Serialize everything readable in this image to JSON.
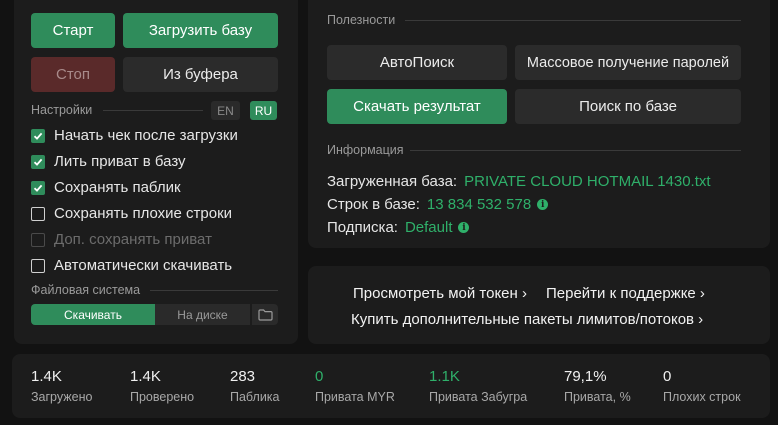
{
  "controls": {
    "start": "Старт",
    "load_base": "Загрузить базу",
    "stop": "Стоп",
    "from_buffer": "Из буфера"
  },
  "settings": {
    "label": "Настройки",
    "lang_en": "EN",
    "lang_ru": "RU",
    "options": [
      {
        "label": "Начать чек после загрузки",
        "checked": true
      },
      {
        "label": "Лить приват в базу",
        "checked": true
      },
      {
        "label": "Сохранять паблик",
        "checked": true
      },
      {
        "label": "Сохранять плохие строки",
        "checked": false
      },
      {
        "label": "Доп. сохранять приват",
        "checked": false,
        "disabled": true
      },
      {
        "label": "Автоматически скачивать",
        "checked": false
      }
    ]
  },
  "filesystem": {
    "label": "Файловая система",
    "download": "Скачивать",
    "on_disk": "На диске",
    "folder_icon": "folder-icon"
  },
  "utilities": {
    "label": "Полезности",
    "autosearch": "АвтоПоиск",
    "mass_passwords": "Массовое получение паролей",
    "download_result": "Скачать результат",
    "search_base": "Поиск по базе"
  },
  "information": {
    "label": "Информация",
    "loaded_base_key": "Загруженная база:",
    "loaded_base_value": "PRIVATE CLOUD HOTMAIL 1430.txt",
    "lines_key": "Строк в базе:",
    "lines_value": "13 834 532 578",
    "subscription_key": "Подписка:",
    "subscription_value": "Default",
    "info_icon": "i"
  },
  "links": {
    "token": "Просмотреть мой токен ›",
    "support": "Перейти к поддержке ›",
    "buy_packages": "Купить дополнительные пакеты лимитов/потоков ›"
  },
  "stats": [
    {
      "value": "1.4K",
      "label": "Загружено",
      "green": false
    },
    {
      "value": "1.4K",
      "label": "Проверено",
      "green": false
    },
    {
      "value": "283",
      "label": "Паблика",
      "green": false
    },
    {
      "value": "0",
      "label": "Привата MYR",
      "green": true
    },
    {
      "value": "1.1K",
      "label": "Привата Забугра",
      "green": true
    },
    {
      "value": "79,1%",
      "label": "Привата, %",
      "green": false
    },
    {
      "value": "0",
      "label": "Плохих строк",
      "green": false
    }
  ],
  "colors": {
    "accent": "#2f8c5b",
    "accent_text": "#2fb06a",
    "stop": "#5a2a2a"
  }
}
